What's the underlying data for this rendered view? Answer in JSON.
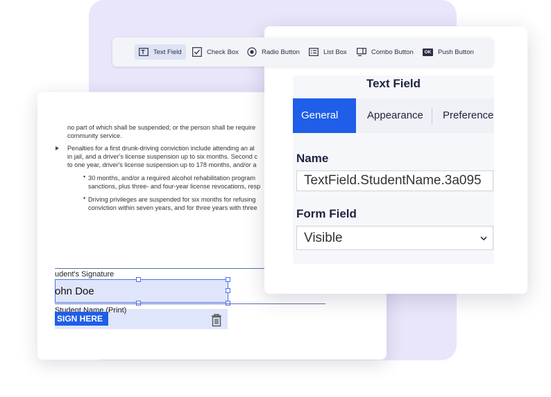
{
  "toolbar": {
    "tools": [
      {
        "label": "Text Field",
        "icon": "text-field-icon",
        "active": true
      },
      {
        "label": "Check Box",
        "icon": "checkbox-icon"
      },
      {
        "label": "Radio Button",
        "icon": "radio-button-icon"
      },
      {
        "label": "List Box",
        "icon": "list-box-icon"
      },
      {
        "label": "Combo Button",
        "icon": "combo-button-icon"
      },
      {
        "label": "Push Button",
        "icon": "push-button-icon",
        "badge": "OK"
      }
    ]
  },
  "document": {
    "lines": [
      "no part of which shall be suspended; or the person shall be require",
      "community service.",
      "Penalties for a first drunk-driving conviction include attending an al",
      "in jail, and a driver's license suspension up to six months. Second c",
      "to one year, driver's license suspension up to 178 months, and/or a",
      "30 months, and/or a required alcohol rehabilitation program",
      "sanctions, plus three- and four-year license revocations, resp",
      "Driving privileges are suspended for six months for refusing",
      "conviction within seven years, and for three years with three"
    ],
    "signature_label": "udent's Signature",
    "signature_value": "ohn Doe",
    "name_label": "Student Name (Print)",
    "sign_here": "SIGN HERE",
    "trash_icon": "trash-icon"
  },
  "panel": {
    "title": "Text Field",
    "tabs": [
      {
        "label": "General",
        "active": true
      },
      {
        "label": "Appearance"
      },
      {
        "label": "Preferences"
      }
    ],
    "name_label": "Name",
    "name_value": "TextField.StudentName.3a095",
    "form_field_label": "Form Field",
    "form_field_value": "Visible",
    "accent_color": "#1f5ee8"
  }
}
